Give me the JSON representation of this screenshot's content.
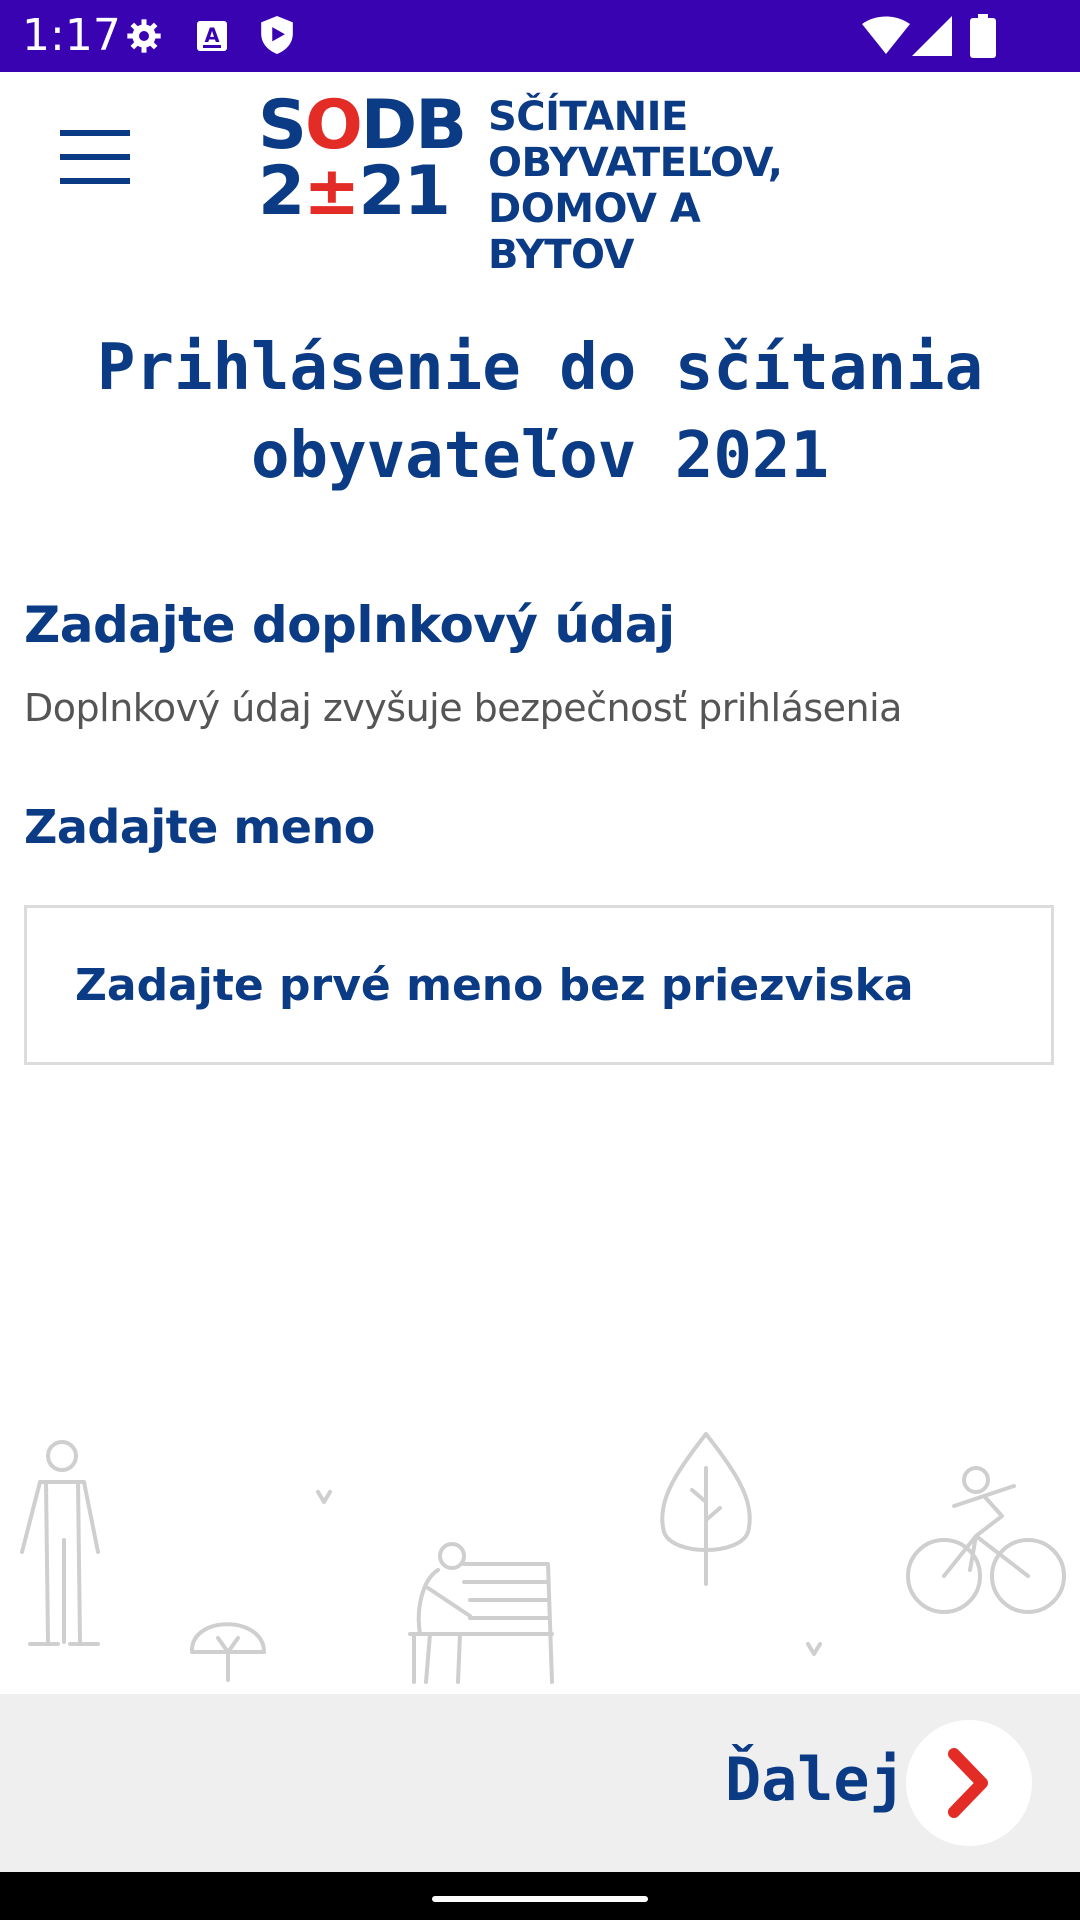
{
  "status_bar": {
    "time": "1:17",
    "icons": [
      "gear-icon",
      "a-keyboard-icon",
      "shield-icon",
      "wifi-icon",
      "signal-icon",
      "battery-icon"
    ],
    "background": "#3a03b2"
  },
  "header": {
    "menu_icon": "hamburger-menu-icon",
    "logo": {
      "mark_top": "SODB",
      "mark_bottom": "2±21",
      "lines": [
        "SČÍTANIE",
        "OBYVATEĽOV,",
        "DOMOV A BYTOV"
      ]
    }
  },
  "page": {
    "title": "Prihlásenie do sčítania obyvateľov 2021",
    "section_heading": "Zadajte doplnkový údaj",
    "section_subtext": "Doplnkový údaj zvyšuje bezpečnosť prihlásenia",
    "name_label": "Zadajte meno",
    "name_input": {
      "value": "",
      "placeholder": "Zadajte prvé meno bez priezviska"
    }
  },
  "footer": {
    "next_label": "Ďalej",
    "next_icon": "chevron-right-icon"
  },
  "colors": {
    "primary": "#0b3b84",
    "accent": "#e32c26",
    "footer_bg": "#efefef"
  }
}
